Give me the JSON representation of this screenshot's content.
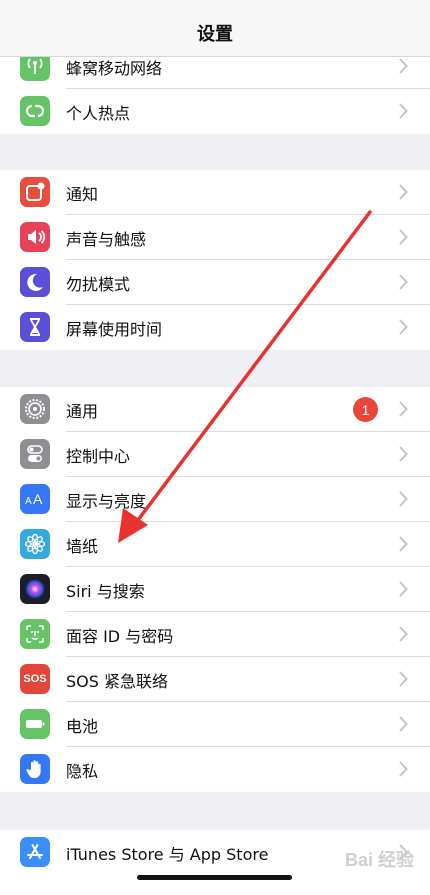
{
  "nav": {
    "title": "设置"
  },
  "group1": [
    {
      "label": "蜂窝移动网络",
      "icon": "antenna-icon",
      "color": "#65c466"
    },
    {
      "label": "个人热点",
      "icon": "hotspot-link-icon",
      "color": "#65c466"
    }
  ],
  "group2": [
    {
      "label": "通知",
      "icon": "notification-icon",
      "color": "#ea4d3d"
    },
    {
      "label": "声音与触感",
      "icon": "speaker-icon",
      "color": "#e8425a"
    },
    {
      "label": "勿扰模式",
      "icon": "moon-icon",
      "color": "#5a4fd6"
    },
    {
      "label": "屏幕使用时间",
      "icon": "hourglass-icon",
      "color": "#5a4fd6"
    }
  ],
  "group3": [
    {
      "label": "通用",
      "icon": "gear-icon",
      "color": "#8e8e93",
      "badge": "1"
    },
    {
      "label": "控制中心",
      "icon": "toggles-icon",
      "color": "#8e8e93"
    },
    {
      "label": "显示与亮度",
      "icon": "text-size-icon",
      "color": "#3478f6"
    },
    {
      "label": "墙纸",
      "icon": "flower-icon",
      "color": "#35aadc"
    },
    {
      "label": "Siri 与搜索",
      "icon": "siri-icon",
      "color": "#1c1c2a"
    },
    {
      "label": "面容 ID 与密码",
      "icon": "face-id-icon",
      "color": "#65c466"
    },
    {
      "label": "SOS 紧急联络",
      "icon": "sos-icon",
      "color": "#e3453a",
      "icon_text": "SOS"
    },
    {
      "label": "电池",
      "icon": "battery-icon",
      "color": "#65c466"
    },
    {
      "label": "隐私",
      "icon": "hand-icon",
      "color": "#3478f6"
    }
  ],
  "group4": [
    {
      "label": "iTunes Store 与 App Store",
      "icon": "app-store-icon",
      "color": "#3a8ff6"
    }
  ],
  "annotation": {
    "arrow_color": "#e8322f"
  }
}
